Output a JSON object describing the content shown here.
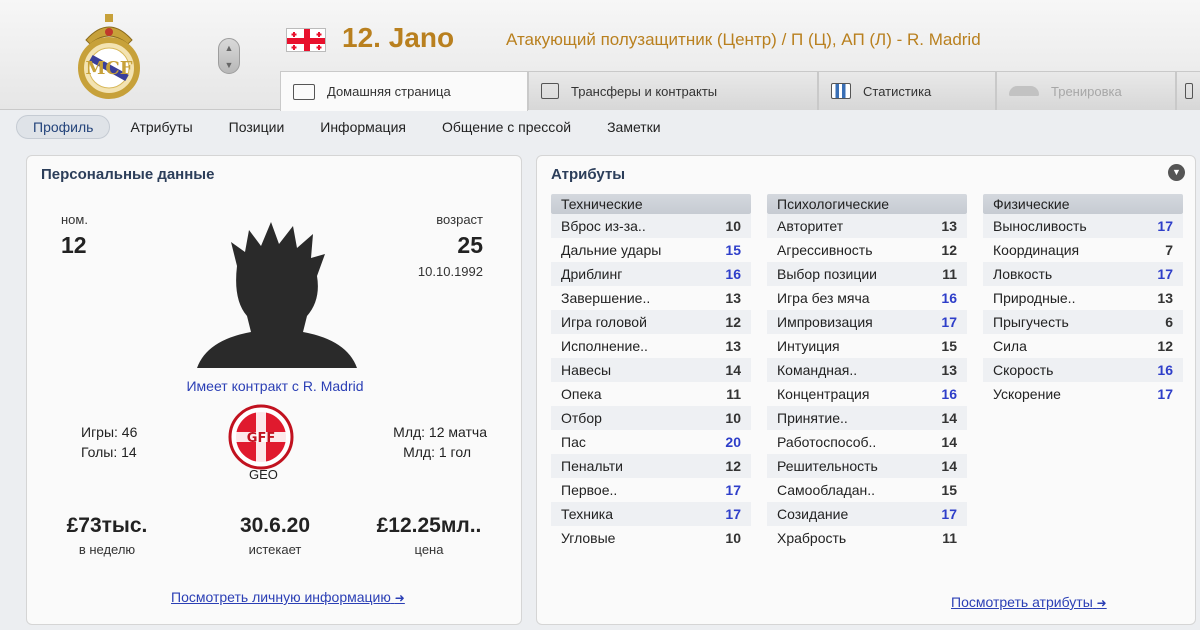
{
  "header": {
    "number_name": "12. Jano",
    "position": "Атакующий полузащитник (Центр) / П (Ц), АП (Л) - R. Madrid",
    "tabs": [
      {
        "label": "Домашняя страница"
      },
      {
        "label": "Трансферы и контракты"
      },
      {
        "label": "Статистика"
      },
      {
        "label": "Тренировка"
      }
    ]
  },
  "subnav": {
    "items": [
      "Профиль",
      "Атрибуты",
      "Позиции",
      "Информация",
      "Общение с прессой",
      "Заметки"
    ]
  },
  "personal": {
    "title": "Персональные данные",
    "number_label": "ном.",
    "number": "12",
    "age_label": "возраст",
    "age": "25",
    "dob": "10.10.1992",
    "contract_text": "Имеет контракт с R. Madrid",
    "games": "Игры: 46",
    "goals": "Голы: 14",
    "youth_games": "Млд: 12 матча",
    "youth_goals": "Млд: 1 гол",
    "nation": "GEO",
    "fed_letters": "GFF",
    "wage": "£73тыс.",
    "wage_label": "в неделю",
    "expires": "30.6.20",
    "expires_label": "истекает",
    "value": "£12.25мл..",
    "value_label": "цена",
    "more_link": "Посмотреть личную информацию"
  },
  "attributes": {
    "title": "Атрибуты",
    "more_link": "Посмотреть атрибуты",
    "columns": [
      {
        "heading": "Технические",
        "rows": [
          {
            "name": "Вброс из-за..",
            "value": "10",
            "hi": false
          },
          {
            "name": "Дальние удары",
            "value": "15",
            "hi": true
          },
          {
            "name": "Дриблинг",
            "value": "16",
            "hi": true
          },
          {
            "name": "Завершение..",
            "value": "13",
            "hi": false
          },
          {
            "name": "Игра головой",
            "value": "12",
            "hi": false
          },
          {
            "name": "Исполнение..",
            "value": "13",
            "hi": false
          },
          {
            "name": "Навесы",
            "value": "14",
            "hi": false
          },
          {
            "name": "Опека",
            "value": "11",
            "hi": false
          },
          {
            "name": "Отбор",
            "value": "10",
            "hi": false
          },
          {
            "name": "Пас",
            "value": "20",
            "hi": true
          },
          {
            "name": "Пенальти",
            "value": "12",
            "hi": false
          },
          {
            "name": "Первое..",
            "value": "17",
            "hi": true
          },
          {
            "name": "Техника",
            "value": "17",
            "hi": true
          },
          {
            "name": "Угловые",
            "value": "10",
            "hi": false
          }
        ]
      },
      {
        "heading": "Психологические",
        "rows": [
          {
            "name": "Авторитет",
            "value": "13",
            "hi": false
          },
          {
            "name": "Агрессивность",
            "value": "12",
            "hi": false
          },
          {
            "name": "Выбор позиции",
            "value": "11",
            "hi": false
          },
          {
            "name": "Игра без мяча",
            "value": "16",
            "hi": true
          },
          {
            "name": "Импровизация",
            "value": "17",
            "hi": true
          },
          {
            "name": "Интуиция",
            "value": "15",
            "hi": false
          },
          {
            "name": "Командная..",
            "value": "13",
            "hi": false
          },
          {
            "name": "Концентрация",
            "value": "16",
            "hi": true
          },
          {
            "name": "Принятие..",
            "value": "14",
            "hi": false
          },
          {
            "name": "Работоспособ..",
            "value": "14",
            "hi": false
          },
          {
            "name": "Решительность",
            "value": "14",
            "hi": false
          },
          {
            "name": "Самообладан..",
            "value": "15",
            "hi": false
          },
          {
            "name": "Созидание",
            "value": "17",
            "hi": true
          },
          {
            "name": "Храбрость",
            "value": "11",
            "hi": false
          }
        ]
      },
      {
        "heading": "Физические",
        "rows": [
          {
            "name": "Выносливость",
            "value": "17",
            "hi": true
          },
          {
            "name": "Координация",
            "value": "7",
            "hi": false
          },
          {
            "name": "Ловкость",
            "value": "17",
            "hi": true
          },
          {
            "name": "Природные..",
            "value": "13",
            "hi": false
          },
          {
            "name": "Прыгучесть",
            "value": "6",
            "hi": false
          },
          {
            "name": "Сила",
            "value": "12",
            "hi": false
          },
          {
            "name": "Скорость",
            "value": "16",
            "hi": true
          },
          {
            "name": "Ускорение",
            "value": "17",
            "hi": true
          }
        ]
      }
    ]
  },
  "colors": {
    "accent_gold": "#b9801f",
    "link_blue": "#2b3fb5",
    "high_value_blue": "#2e3ec9"
  }
}
